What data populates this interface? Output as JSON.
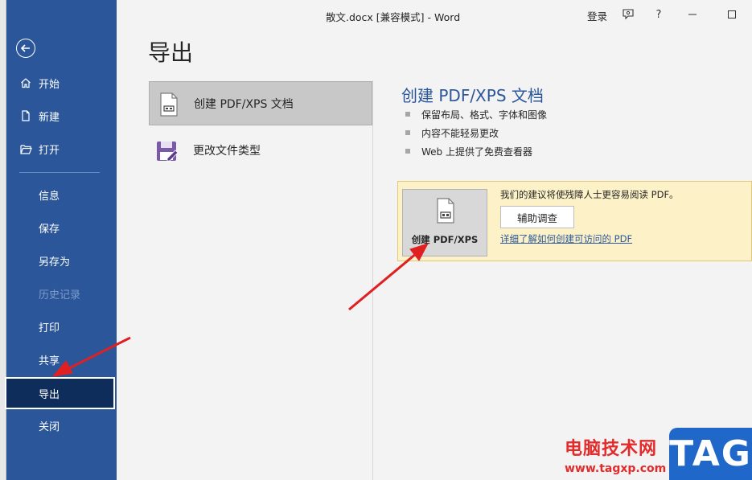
{
  "window": {
    "title": "散文.docx [兼容模式]  -  Word",
    "login": "登录",
    "help": "?"
  },
  "sidebar": {
    "items": [
      {
        "label": "开始",
        "icon": "home-icon"
      },
      {
        "label": "新建",
        "icon": "new-doc-icon"
      },
      {
        "label": "打开",
        "icon": "open-folder-icon"
      },
      {
        "label": "信息"
      },
      {
        "label": "保存"
      },
      {
        "label": "另存为"
      },
      {
        "label": "历史记录",
        "disabled": true
      },
      {
        "label": "打印"
      },
      {
        "label": "共享"
      },
      {
        "label": "导出",
        "selected": true
      },
      {
        "label": "关闭"
      }
    ]
  },
  "main": {
    "title": "导出",
    "options": [
      {
        "label": "创建 PDF/XPS 文档",
        "selected": true
      },
      {
        "label": "更改文件类型"
      }
    ],
    "detail": {
      "title": "创建 PDF/XPS 文档",
      "bullets": [
        "保留布局、格式、字体和图像",
        "内容不能轻易更改",
        "Web 上提供了免费查看器"
      ],
      "create_button": "创建 PDF/XPS",
      "accessibility_text": "我们的建议将使残障人士更容易阅读 PDF。",
      "accessibility_button": "辅助调查",
      "accessibility_link": "详细了解如何创建可访问的 PDF"
    }
  },
  "watermark": {
    "text": "电脑技术网",
    "url": "www.tagxp.com",
    "logo": "TAG"
  },
  "colors": {
    "sidebar": "#2b579a",
    "sidebar_selected": "#0e2d5b",
    "accent": "#2b579a",
    "info_box": "#fdf2c7",
    "annotation_arrow": "#e02020"
  }
}
